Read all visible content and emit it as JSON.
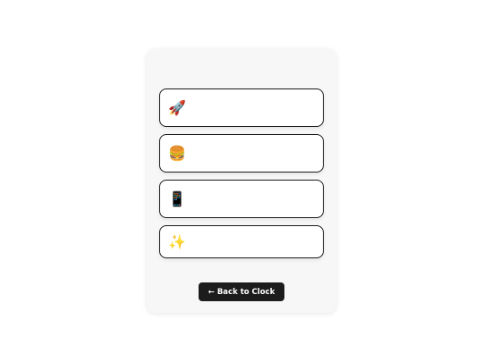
{
  "list": {
    "items": [
      {
        "emoji": "🚀",
        "icon": "rocket-icon"
      },
      {
        "emoji": "🍔",
        "icon": "burger-icon"
      },
      {
        "emoji": "📱",
        "icon": "mobile-phone-icon"
      },
      {
        "emoji": "✨",
        "icon": "sparkles-icon"
      }
    ]
  },
  "footer": {
    "back_label": "← Back to Clock"
  }
}
